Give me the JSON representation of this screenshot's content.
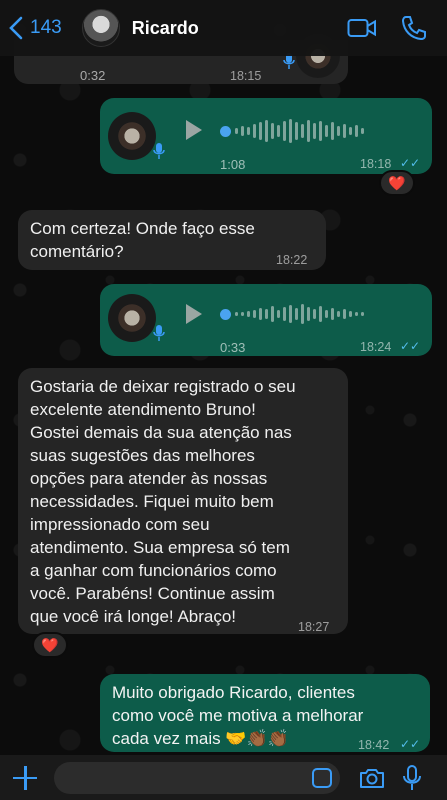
{
  "header": {
    "back_count": "143",
    "contact_name": "Ricardo"
  },
  "voice_partial": {
    "duration": "0:32",
    "time": "18:15"
  },
  "voice1": {
    "duration": "1:08",
    "time": "18:18",
    "reaction": "❤️"
  },
  "msg1": {
    "line1": "Com certeza! Onde faço esse",
    "line2": "comentário?",
    "time": "18:22"
  },
  "voice2": {
    "duration": "0:33",
    "time": "18:24"
  },
  "msg2": {
    "lines": [
      "Gostaria de deixar registrado o seu",
      "excelente atendimento  Bruno!",
      "Gostei demais da sua atenção nas",
      "suas sugestões das melhores",
      "opções para atender às nossas",
      "necessidades.  Fiquei muito bem",
      "impressionado com seu",
      "atendimento.  Sua empresa só tem",
      "a ganhar com funcionários como",
      "você. Parabéns! Continue assim",
      "que você irá longe! Abraço!"
    ],
    "time": "18:27",
    "reaction": "❤️"
  },
  "msg3": {
    "line1": "Muito obrigado Ricardo, clientes",
    "line2": "como você me motiva a melhorar",
    "line3": "cada vez mais 🤝👏🏾👏🏾",
    "time": "18:42"
  },
  "colors": {
    "accent": "#3a9bf5",
    "outgoing_bubble": "#0d5c4a",
    "incoming_bubble": "#252525",
    "read_ticks": "#53bdeb"
  },
  "icons": {
    "back": "chevron-left-icon",
    "video": "video-camera-icon",
    "call": "phone-icon",
    "sticker": "sticker-icon",
    "camera": "camera-icon",
    "mic": "microphone-icon",
    "plus": "plus-icon"
  }
}
